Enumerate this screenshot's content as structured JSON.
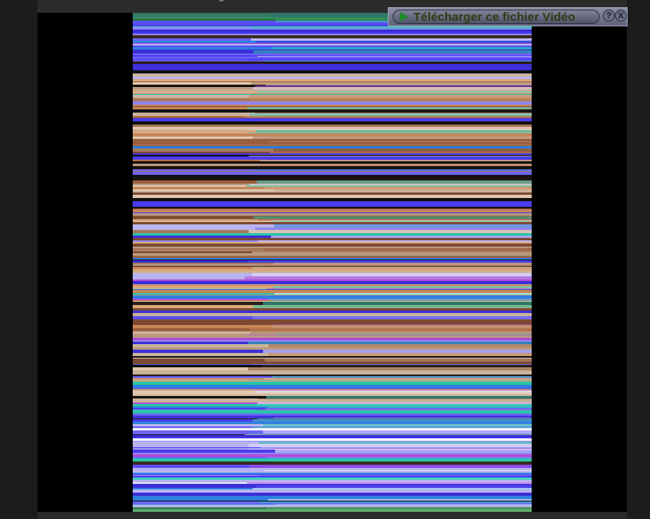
{
  "banner": {
    "download_label": "Télécharger ce fichier Vidéo",
    "help_label": "?",
    "close_label": "X"
  },
  "player": {
    "muted": true
  },
  "icons": {
    "play": "play-icon",
    "help": "help-icon",
    "close": "close-icon",
    "mute": "speaker-muted-icon"
  },
  "colors": {
    "video_base": "#4b3cf0",
    "banner_bg": "#6e7188",
    "play_green": "#1f8a2a",
    "mute_icon": "#ffffff"
  }
}
